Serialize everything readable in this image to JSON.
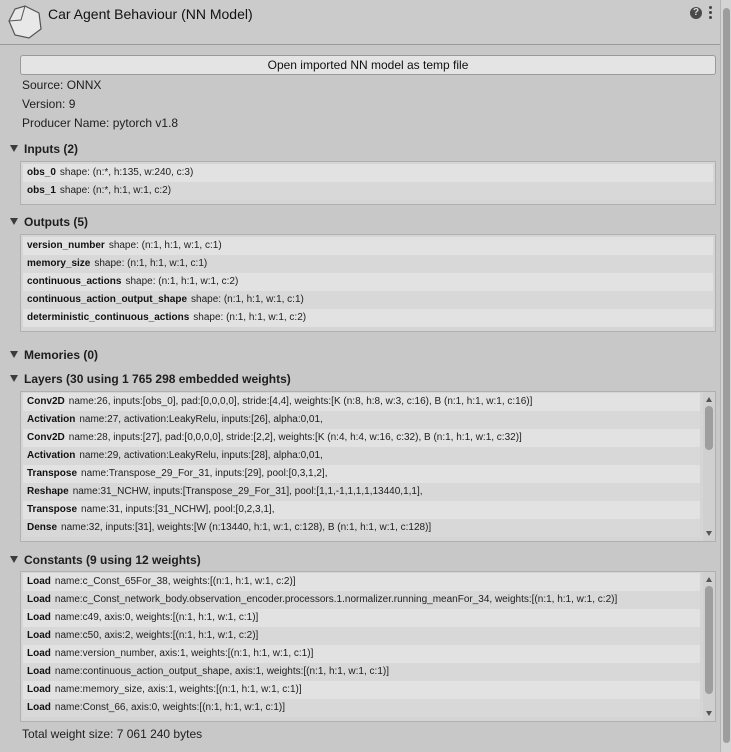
{
  "header": {
    "title": "Car Agent Behaviour (NN Model)",
    "help_icon": "?",
    "menu_icon": "kebab-menu"
  },
  "open_button": "Open imported NN model as temp file",
  "info": {
    "source": "Source: ONNX",
    "version": "Version: 9",
    "producer": "Producer Name: pytorch v1.8"
  },
  "inputs": {
    "header": "Inputs (2)",
    "rows": [
      {
        "name": "obs_0",
        "desc": "shape: (n:*, h:135, w:240, c:3)"
      },
      {
        "name": "obs_1",
        "desc": "shape: (n:*, h:1, w:1, c:2)"
      }
    ]
  },
  "outputs": {
    "header": "Outputs (5)",
    "rows": [
      {
        "name": "version_number",
        "desc": "shape: (n:1, h:1, w:1, c:1)"
      },
      {
        "name": "memory_size",
        "desc": "shape: (n:1, h:1, w:1, c:1)"
      },
      {
        "name": "continuous_actions",
        "desc": "shape: (n:1, h:1, w:1, c:2)"
      },
      {
        "name": "continuous_action_output_shape",
        "desc": "shape: (n:1, h:1, w:1, c:1)"
      },
      {
        "name": "deterministic_continuous_actions",
        "desc": "shape: (n:1, h:1, w:1, c:2)"
      }
    ]
  },
  "memories": {
    "header": "Memories (0)"
  },
  "layers": {
    "header": "Layers (30 using 1 765 298 embedded weights)",
    "rows": [
      {
        "name": "Conv2D",
        "desc": "name:26, inputs:[obs_0], pad:[0,0,0,0], stride:[4,4], weights:[K (n:8, h:8, w:3, c:16), B (n:1, h:1, w:1, c:16)]"
      },
      {
        "name": "Activation",
        "desc": "name:27, activation:LeakyRelu, inputs:[26], alpha:0,01,"
      },
      {
        "name": "Conv2D",
        "desc": "name:28, inputs:[27], pad:[0,0,0,0], stride:[2,2], weights:[K (n:4, h:4, w:16, c:32), B (n:1, h:1, w:1, c:32)]"
      },
      {
        "name": "Activation",
        "desc": "name:29, activation:LeakyRelu, inputs:[28], alpha:0,01,"
      },
      {
        "name": "Transpose",
        "desc": "name:Transpose_29_For_31, inputs:[29], pool:[0,3,1,2],"
      },
      {
        "name": "Reshape",
        "desc": "name:31_NCHW, inputs:[Transpose_29_For_31], pool:[1,1,-1,1,1,1,13440,1,1],"
      },
      {
        "name": "Transpose",
        "desc": "name:31, inputs:[31_NCHW], pool:[0,2,3,1],"
      },
      {
        "name": "Dense",
        "desc": "name:32, inputs:[31], weights:[W (n:13440, h:1, w:1, c:128), B (n:1, h:1, w:1, c:128)]"
      }
    ]
  },
  "constants": {
    "header": "Constants (9 using 12 weights)",
    "rows": [
      {
        "name": "Load",
        "desc": "name:c_Const_65For_38, weights:[(n:1, h:1, w:1, c:2)]"
      },
      {
        "name": "Load",
        "desc": "name:c_Const_network_body.observation_encoder.processors.1.normalizer.running_meanFor_34, weights:[(n:1, h:1, w:1, c:2)]"
      },
      {
        "name": "Load",
        "desc": "name:c49, axis:0, weights:[(n:1, h:1, w:1, c:1)]"
      },
      {
        "name": "Load",
        "desc": "name:c50, axis:2, weights:[(n:1, h:1, w:1, c:2)]"
      },
      {
        "name": "Load",
        "desc": "name:version_number, axis:1, weights:[(n:1, h:1, w:1, c:1)]"
      },
      {
        "name": "Load",
        "desc": "name:continuous_action_output_shape, axis:1, weights:[(n:1, h:1, w:1, c:1)]"
      },
      {
        "name": "Load",
        "desc": "name:memory_size, axis:1, weights:[(n:1, h:1, w:1, c:1)]"
      },
      {
        "name": "Load",
        "desc": "name:Const_66, axis:0, weights:[(n:1, h:1, w:1, c:1)]"
      }
    ]
  },
  "total": "Total weight size: 7 061 240 bytes"
}
